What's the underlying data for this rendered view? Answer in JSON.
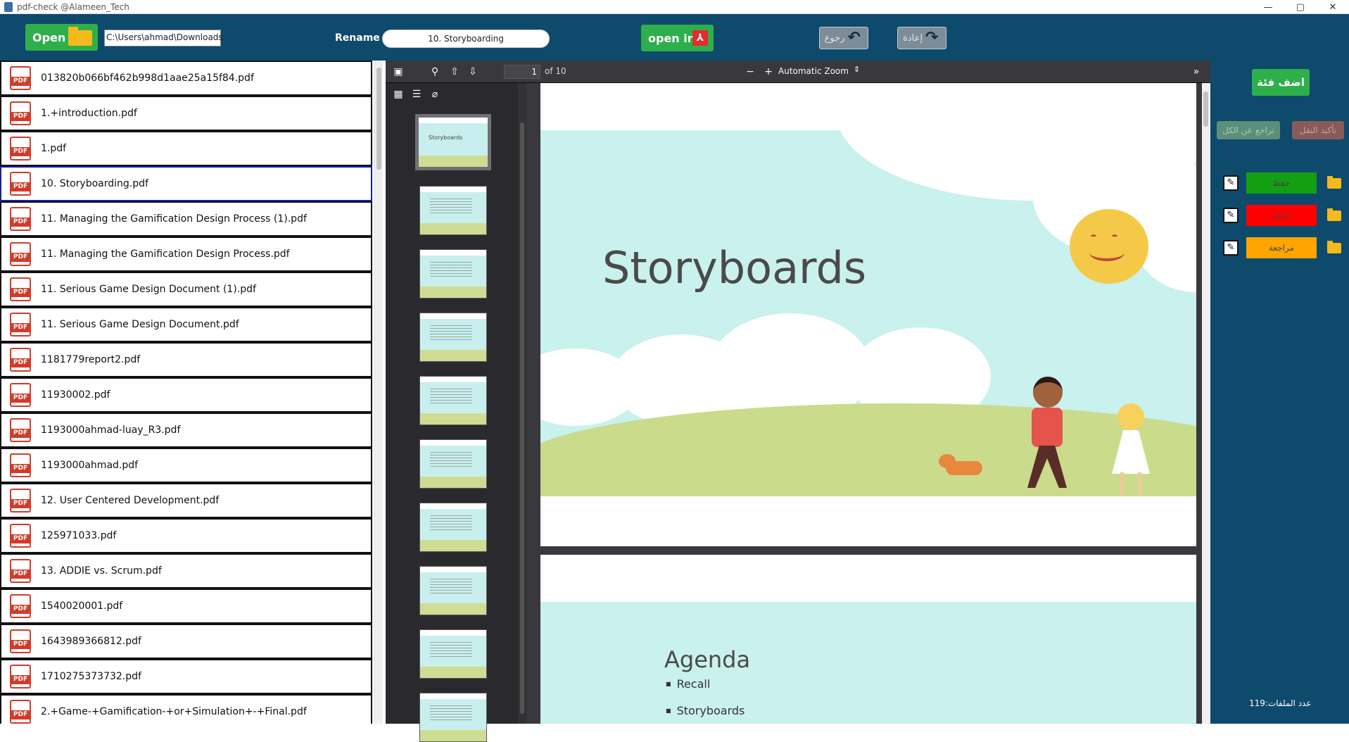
{
  "window": {
    "title": "pdf-check @Alameen_Tech",
    "controls": [
      "—",
      "▢",
      "✕"
    ]
  },
  "toolbar": {
    "open_label": "Open",
    "path_value": "C:\\Users\\ahmad\\Downloads",
    "rename_label": "Rename",
    "rename_value": "10. Storyboarding",
    "open_in_label": "open in",
    "back_label": "رجوع",
    "redo_label": "إعادة"
  },
  "files": [
    "013820b066bf462b998d1aae25a15f84.pdf",
    "1.+introduction.pdf",
    "1.pdf",
    "10. Storyboarding.pdf",
    "11. Managing the Gamification Design Process (1).pdf",
    "11. Managing the Gamification Design Process.pdf",
    "11. Serious Game Design Document (1).pdf",
    "11. Serious Game Design Document.pdf",
    "1181779report2.pdf",
    "11930002.pdf",
    "1193000ahmad-luay_R3.pdf",
    "1193000ahmad.pdf",
    "12. User Centered Development.pdf",
    "125971033.pdf",
    "13. ADDIE vs. Scrum.pdf",
    "1540020001.pdf",
    "1643989366812.pdf",
    "1710275373732.pdf",
    "2.+Game-+Gamification-+or+Simulation+-+Final.pdf"
  ],
  "selected_file": "10. Storyboarding.pdf",
  "pdf_badge": "PDF",
  "viewer": {
    "page_number": "1",
    "page_of": "of 10",
    "zoom": "Automatic Zoom",
    "thumbnail_title": "Storyboards",
    "slide1_title": "Storyboards",
    "slide2_title": "Agenda",
    "slide2_items": [
      "Recall",
      "Storyboards"
    ]
  },
  "right_panel": {
    "add_category_label": "اضف فئة",
    "undo_all_label": "تراجع عن الكل",
    "confirm_move_label": "تأكيد النقل",
    "categories": [
      {
        "label": "حفظ",
        "color": "#12a012"
      },
      {
        "label": "حذف",
        "color": "#ff0000"
      },
      {
        "label": "مراجعة",
        "color": "#ffa500"
      }
    ],
    "file_count": "عدد الملفات:119"
  }
}
